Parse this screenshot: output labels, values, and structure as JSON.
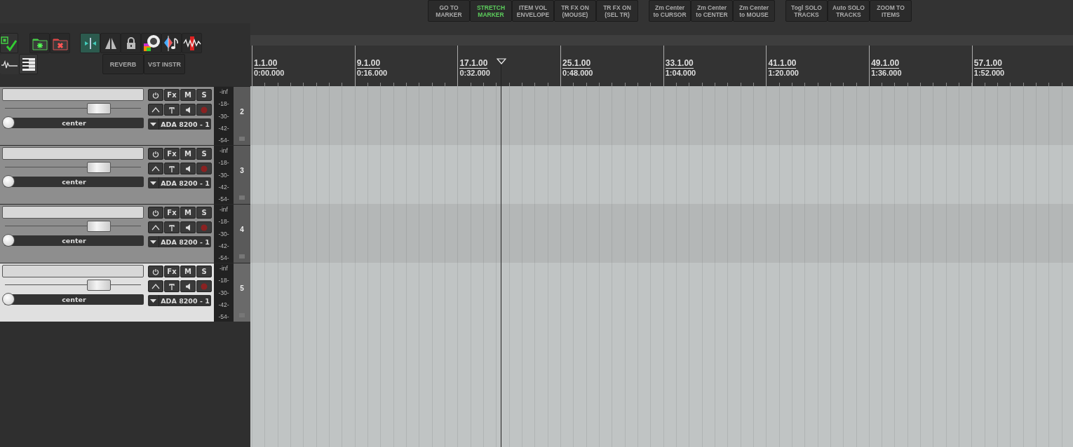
{
  "toolbar_groups": [
    [
      {
        "top": "GO TO",
        "bottom": "MARKER",
        "active": false
      },
      {
        "top": "STRETCH",
        "bottom": "MARKER",
        "active": true
      },
      {
        "top": "ITEM VOL",
        "bottom": "ENVELOPE",
        "active": false
      },
      {
        "top": "TR FX ON",
        "bottom": "(MOUSE)",
        "active": false
      },
      {
        "top": "TR FX ON",
        "bottom": "(SEL TR)",
        "active": false
      }
    ],
    [
      {
        "top": "Zm Center",
        "bottom": "to CURSOR",
        "active": false
      },
      {
        "top": "Zm Center",
        "bottom": "to CENTER",
        "active": false
      },
      {
        "top": "Zm Center",
        "bottom": "to MOUSE",
        "active": false
      }
    ],
    [
      {
        "top": "Togl SOLO",
        "bottom": "TRACKS",
        "active": false
      },
      {
        "top": "Auto SOLO",
        "bottom": "TRACKS",
        "active": false
      },
      {
        "top": "ZOOM TO",
        "bottom": "ITEMS",
        "active": false
      }
    ]
  ],
  "icon_toolbar": [
    {
      "kind": "check"
    },
    {
      "kind": "folder-add",
      "active": false
    },
    {
      "kind": "folder-remove",
      "active": false
    },
    {
      "kind": "ripple",
      "active": true
    },
    {
      "kind": "mirror",
      "active": false
    },
    {
      "kind": "lock",
      "active": false
    },
    {
      "kind": "sws",
      "active": false
    },
    {
      "kind": "note",
      "active": false
    },
    {
      "kind": "wave-red",
      "active": false
    }
  ],
  "icon_toolbar_2": [
    {
      "kind": "waveform"
    },
    {
      "kind": "piano"
    }
  ],
  "fx_buttons": [
    "REVERB",
    "VST INSTR"
  ],
  "ruler": [
    {
      "bar": "1.1.00",
      "time": "0:00.000"
    },
    {
      "bar": "9.1.00",
      "time": "0:16.000"
    },
    {
      "bar": "17.1.00",
      "time": "0:32.000"
    },
    {
      "bar": "25.1.00",
      "time": "0:48.000"
    },
    {
      "bar": "33.1.00",
      "time": "1:04.000"
    },
    {
      "bar": "41.1.00",
      "time": "1:20.000"
    },
    {
      "bar": "49.1.00",
      "time": "1:36.000"
    },
    {
      "bar": "57.1.00",
      "time": "1:52.000"
    }
  ],
  "tracks": [
    {
      "number": "2",
      "buttons": [
        "Fx",
        "M",
        "S"
      ],
      "selected": false,
      "level": 0.69,
      "pan": "center",
      "input": "ADA 8200 - 1",
      "meter": [
        "-inf",
        "-18-",
        "-30-",
        "-42-",
        "-54-"
      ]
    },
    {
      "number": "3",
      "buttons": [
        "Fx",
        "M",
        "S"
      ],
      "selected": false,
      "level": 0.69,
      "pan": "center",
      "input": "ADA 8200 - 1",
      "meter": [
        "-inf",
        "-18-",
        "-30-",
        "-42-",
        "-54-"
      ]
    },
    {
      "number": "4",
      "buttons": [
        "Fx",
        "M",
        "S"
      ],
      "selected": false,
      "level": 0.69,
      "pan": "center",
      "input": "ADA 8200 - 1",
      "meter": [
        "-inf",
        "-18-",
        "-30-",
        "-42-",
        "-54-"
      ]
    },
    {
      "number": "5",
      "buttons": [
        "Fx",
        "M",
        "S"
      ],
      "selected": true,
      "level": 0.69,
      "pan": "center",
      "input": "ADA 8200 - 1",
      "meter": [
        "-inf",
        "-18-",
        "-30-",
        "-42-",
        "-54-"
      ]
    }
  ]
}
